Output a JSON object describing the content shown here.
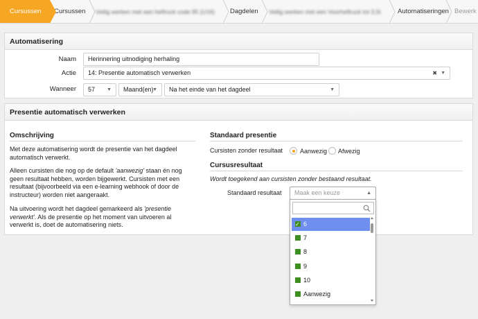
{
  "breadcrumb": {
    "items": [
      {
        "label": "Cursussen",
        "active": true
      },
      {
        "label": "Cursussen"
      },
      {
        "label": "Veilig werken met een heftruck code 95 (U16)",
        "blurred": true
      },
      {
        "label": "Dagdelen"
      },
      {
        "label": "Veilig werken met een Voorheftruck tot 3,5t",
        "blurred": true
      },
      {
        "label": "Automatiseringen"
      },
      {
        "label": "Bewerk"
      }
    ]
  },
  "automation": {
    "title": "Automatisering",
    "name_label": "Naam",
    "name_value": "Herinnering uitnodiging herhaling",
    "action_label": "Actie",
    "action_value": "14: Presentie automatisch verwerken",
    "when_label": "Wanneer",
    "when_number": "57",
    "when_unit": "Maand(en)",
    "when_moment": "Na het einde van het dagdeel"
  },
  "presence": {
    "title": "Presentie automatisch verwerken",
    "description_title": "Omschrijving",
    "p1": "Met deze automatisering wordt de presentie van het dagdeel automatisch verwerkt.",
    "p2_a": "Alleen cursisten die nog op de default ",
    "p2_em": "'aanwezig'",
    "p2_b": " staan én nog geen resultaat hebben, worden bijgewerkt. Cursisten met een resultaat (bijvoorbeeld via een e-learning webhook of door de instructeur) worden niet aangeraakt.",
    "p3_a": "Na uitvoering wordt het dagdeel gemarkeerd als ",
    "p3_em": "'presentie verwerkt'",
    "p3_b": ". Als de presentie op het moment van uitvoeren al verwerkt is, doet de automatisering niets.",
    "default_presence_title": "Standaard presentie",
    "no_result_label": "Cursisten zonder resultaat",
    "option_present": "Aanwezig",
    "option_absent": "Afwezig",
    "selected_option": "Aanwezig",
    "course_result_title": "Cursusresultaat",
    "course_result_note": "Wordt toegekend aan cursisten zonder bestaand resultaat.",
    "default_result_label": "Standaard resultaat",
    "default_result_placeholder": "Maak een keuze"
  },
  "dropdown": {
    "search_value": "",
    "items": [
      {
        "label": "6",
        "selected": true
      },
      {
        "label": "7"
      },
      {
        "label": "8"
      },
      {
        "label": "9"
      },
      {
        "label": "10"
      },
      {
        "label": "Aanwezig"
      }
    ]
  },
  "colors": {
    "accent": "#f5a623",
    "highlight": "#6f8ff0",
    "check_green": "#3e8e21"
  }
}
